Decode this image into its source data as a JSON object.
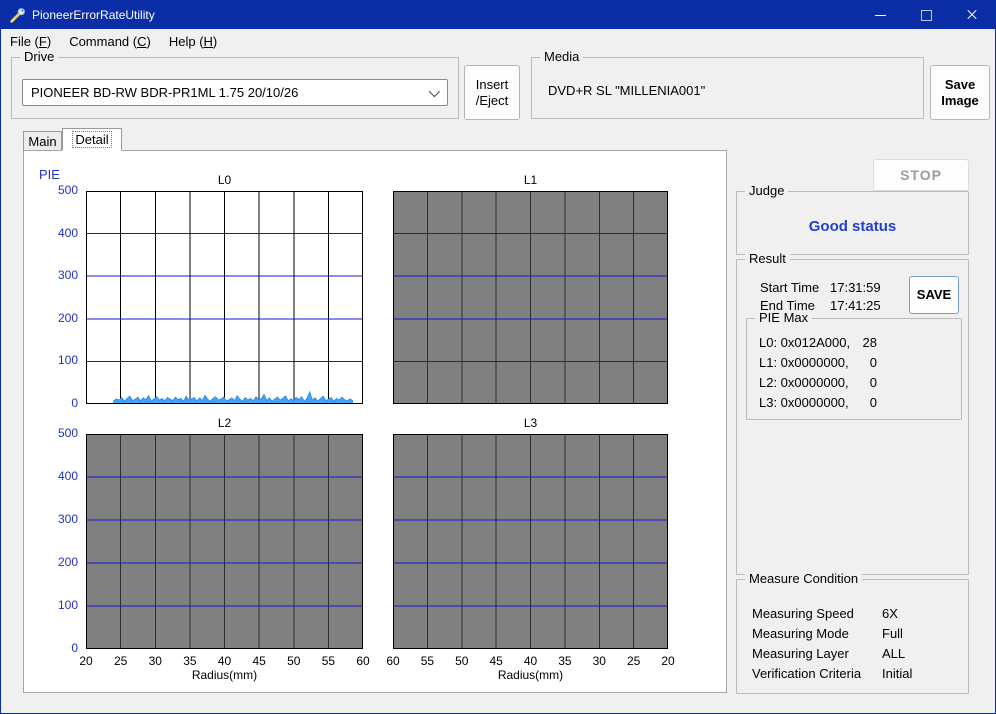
{
  "window": {
    "title": "PioneerErrorRateUtility"
  },
  "menu": {
    "items": [
      "File (F)",
      "Command (C)",
      "Help (H)"
    ]
  },
  "drive": {
    "label": "Drive",
    "value": "PIONEER BD-RW BDR-PR1ML 1.75 20/10/26"
  },
  "media": {
    "label": "Media",
    "value": "DVD+R SL \"MILLENIA001\""
  },
  "buttons": {
    "insert_eject_line1": "Insert",
    "insert_eject_line2": "/Eject",
    "save_image_line1": "Save",
    "save_image_line2": "Image",
    "stop": "STOP",
    "save": "SAVE"
  },
  "tabs": {
    "main": "Main",
    "detail": "Detail"
  },
  "judge": {
    "label": "Judge",
    "status": "Good status"
  },
  "result": {
    "label": "Result",
    "start_time_label": "Start Time",
    "start_time": "17:31:59",
    "end_time_label": "End Time",
    "end_time": "17:41:25",
    "pie_max": {
      "label": "PIE Max",
      "rows": [
        {
          "name": "L0: 0x012A000,",
          "value": "28"
        },
        {
          "name": "L1: 0x0000000,",
          "value": "0"
        },
        {
          "name": "L2: 0x0000000,",
          "value": "0"
        },
        {
          "name": "L3: 0x0000000,",
          "value": "0"
        }
      ]
    }
  },
  "measure_condition": {
    "label": "Measure Condition",
    "rows": [
      {
        "name": "Measuring Speed",
        "value": "6X"
      },
      {
        "name": "Measuring Mode",
        "value": "Full"
      },
      {
        "name": "Measuring Layer",
        "value": "ALL"
      },
      {
        "name": "Verification Criteria",
        "value": "Initial"
      }
    ]
  },
  "chart_data": {
    "type": "line",
    "ylabel": "PIE",
    "ylim": [
      0,
      500
    ],
    "yticks": [
      0,
      100,
      200,
      300,
      400,
      500
    ],
    "h_gridlines": [
      100,
      200,
      300,
      400
    ],
    "v_divisions": 8,
    "colors": {
      "data": "#4aa2f5",
      "data_edge": "#2f8fe8",
      "gridline_blue": "#1616d8",
      "gray_panel": "#808080",
      "tick_blue": "#2233bb"
    },
    "panels": [
      {
        "title": "L0",
        "x_min": 20,
        "x_max": 60,
        "background": "white",
        "has_data": true,
        "series_x_start": 24,
        "series_x_end": 58.5,
        "values": [
          7,
          12,
          9,
          15,
          6,
          13,
          18,
          8,
          11,
          16,
          7,
          14,
          10,
          19,
          6,
          12,
          17,
          9,
          13,
          7,
          15,
          11,
          8,
          16,
          10,
          13,
          6,
          18,
          9,
          12,
          15,
          7,
          14,
          8,
          20,
          11,
          6,
          13,
          17,
          9,
          12,
          16,
          7,
          10,
          14,
          8,
          19,
          11,
          6,
          15,
          9,
          13,
          7,
          17,
          10,
          12,
          22,
          8,
          14,
          6,
          11,
          16,
          9,
          13,
          19,
          7,
          12,
          8,
          15,
          10,
          17,
          6,
          13,
          28,
          9,
          14,
          7,
          12,
          18,
          8,
          11,
          15,
          6,
          13,
          9,
          16,
          10,
          7,
          12,
          8
        ]
      },
      {
        "title": "L1",
        "x_min": 60,
        "x_max": 20,
        "background": "gray",
        "has_data": false
      },
      {
        "title": "L2",
        "x_min": 20,
        "x_max": 60,
        "background": "gray",
        "has_data": false,
        "xticks": [
          20,
          25,
          30,
          35,
          40,
          45,
          50,
          55,
          60
        ],
        "xlabel": "Radius(mm)"
      },
      {
        "title": "L3",
        "x_min": 60,
        "x_max": 20,
        "background": "gray",
        "has_data": false,
        "xticks": [
          60,
          55,
          50,
          45,
          40,
          35,
          30,
          25,
          20
        ],
        "xlabel": "Radius(mm)"
      }
    ]
  }
}
